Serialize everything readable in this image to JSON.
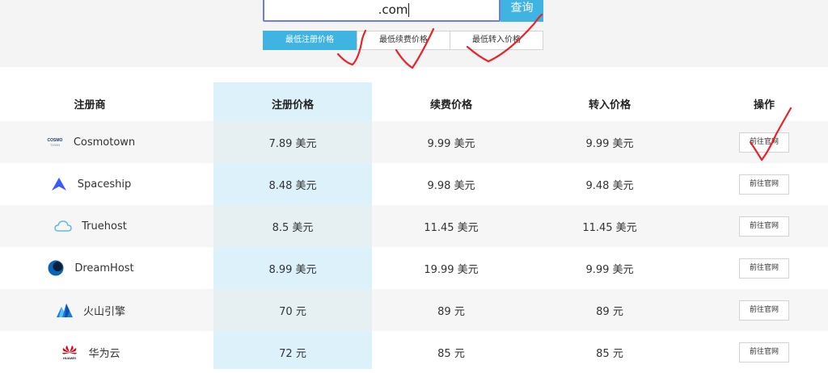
{
  "search": {
    "value": ".com",
    "button_label": "查询"
  },
  "filters": [
    {
      "label": "最低注册价格",
      "active": true
    },
    {
      "label": "最低续费价格",
      "active": false
    },
    {
      "label": "最低转入价格",
      "active": false
    }
  ],
  "table": {
    "headers": {
      "registrar": "注册商",
      "register": "注册价格",
      "renew": "续费价格",
      "transfer": "转入价格",
      "action": "操作"
    },
    "rows": [
      {
        "name": "Cosmotown",
        "icon": "cosmotown-logo",
        "register": "7.89 美元",
        "renew": "9.99 美元",
        "transfer": "9.99 美元",
        "action": "前往官网"
      },
      {
        "name": "Spaceship",
        "icon": "spaceship-logo",
        "register": "8.48 美元",
        "renew": "9.98 美元",
        "transfer": "9.48 美元",
        "action": "前往官网"
      },
      {
        "name": "Truehost",
        "icon": "truehost-logo",
        "register": "8.5 美元",
        "renew": "11.45 美元",
        "transfer": "11.45 美元",
        "action": "前往官网"
      },
      {
        "name": "DreamHost",
        "icon": "dreamhost-logo",
        "register": "8.99 美元",
        "renew": "19.99 美元",
        "transfer": "9.99 美元",
        "action": "前往官网"
      },
      {
        "name": "火山引擎",
        "icon": "volcengine-logo",
        "register": "70 元",
        "renew": "89 元",
        "transfer": "89 元",
        "action": "前往官网"
      },
      {
        "name": "华为云",
        "icon": "huawei-cloud-logo",
        "register": "72 元",
        "renew": "85 元",
        "transfer": "85 元",
        "action": "前往官网"
      }
    ]
  },
  "logo_text": {
    "cosmotown": "COSMO TOWN",
    "huawei": "HUAWEI"
  },
  "colors": {
    "accent": "#3fb4e3",
    "highlight_column": "#dcf1f9",
    "annotation": "#e8232a"
  }
}
